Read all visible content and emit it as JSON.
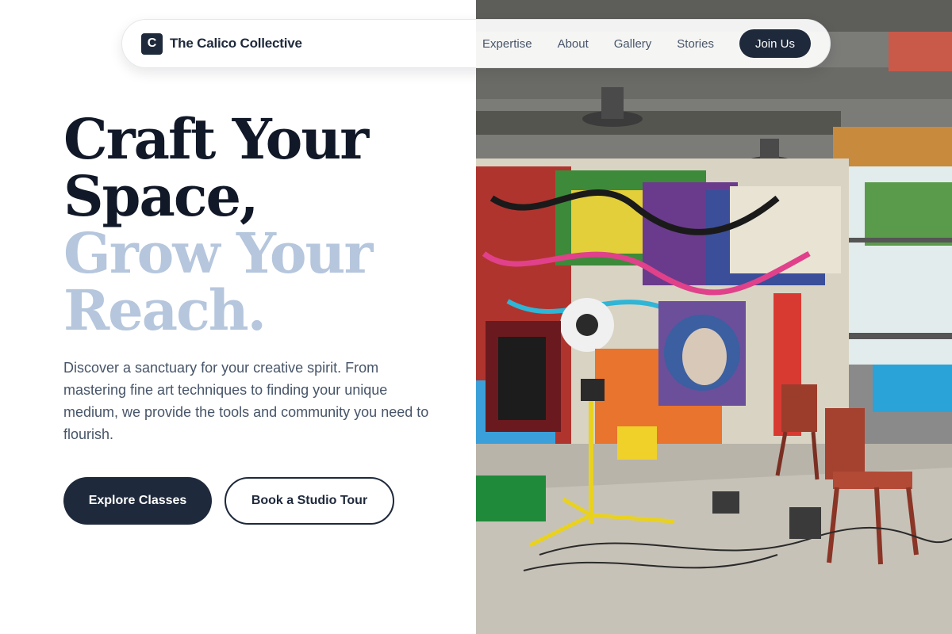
{
  "brand": {
    "logo_letter": "C",
    "name": "The Calico Collective"
  },
  "nav": {
    "links": [
      "Expertise",
      "About",
      "Gallery",
      "Stories"
    ],
    "cta": "Join Us"
  },
  "hero": {
    "title_line_1": "Craft Your",
    "title_line_2": "Space,",
    "title_line_3": "Grow Your",
    "title_line_4": "Reach.",
    "description": "Discover a sanctuary for your creative spirit. From mastering fine art techniques to finding your unique medium, we provide the tools and community you need to flourish.",
    "primary_button": "Explore Classes",
    "secondary_button": "Book a Studio Tour"
  },
  "colors": {
    "navy": "#1e293b",
    "heading_dark": "#111827",
    "heading_light": "#b5c6dd",
    "body_text": "#475569"
  }
}
